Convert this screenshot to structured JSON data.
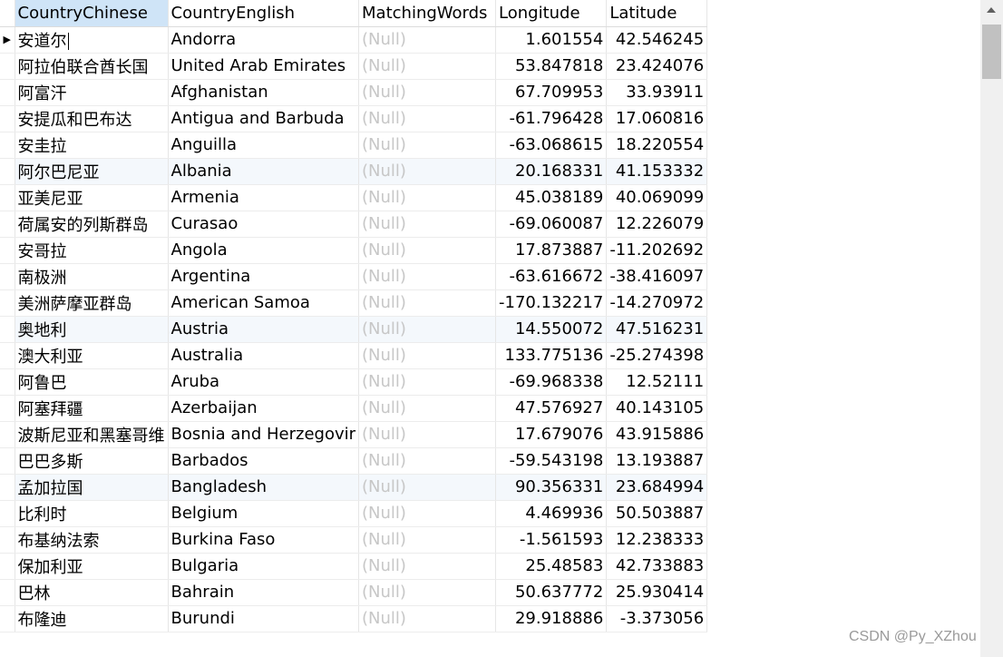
{
  "columns": [
    "CountryChinese",
    "CountryEnglish",
    "MatchingWords",
    "Longitude",
    "Latitude"
  ],
  "rows": [
    {
      "cn": "安道尔",
      "en": "Andorra",
      "mw": "(Null)",
      "lon": "1.601554",
      "lat": "42.546245"
    },
    {
      "cn": "阿拉伯联合酋长国",
      "en": "United Arab Emirates",
      "mw": "(Null)",
      "lon": "53.847818",
      "lat": "23.424076"
    },
    {
      "cn": "阿富汗",
      "en": "Afghanistan",
      "mw": "(Null)",
      "lon": "67.709953",
      "lat": "33.93911"
    },
    {
      "cn": "安提瓜和巴布达",
      "en": "Antigua and Barbuda",
      "mw": "(Null)",
      "lon": "-61.796428",
      "lat": "17.060816"
    },
    {
      "cn": "安圭拉",
      "en": "Anguilla",
      "mw": "(Null)",
      "lon": "-63.068615",
      "lat": "18.220554"
    },
    {
      "cn": "阿尔巴尼亚",
      "en": "Albania",
      "mw": "(Null)",
      "lon": "20.168331",
      "lat": "41.153332"
    },
    {
      "cn": "亚美尼亚",
      "en": "Armenia",
      "mw": "(Null)",
      "lon": "45.038189",
      "lat": "40.069099"
    },
    {
      "cn": "荷属安的列斯群岛",
      "en": "Curasao",
      "mw": "(Null)",
      "lon": "-69.060087",
      "lat": "12.226079"
    },
    {
      "cn": "安哥拉",
      "en": "Angola",
      "mw": "(Null)",
      "lon": "17.873887",
      "lat": "-11.202692"
    },
    {
      "cn": "南极洲",
      "en": "Argentina",
      "mw": "(Null)",
      "lon": "-63.616672",
      "lat": "-38.416097"
    },
    {
      "cn": "美洲萨摩亚群岛",
      "en": "American Samoa",
      "mw": "(Null)",
      "lon": "-170.132217",
      "lat": "-14.270972"
    },
    {
      "cn": "奥地利",
      "en": "Austria",
      "mw": "(Null)",
      "lon": "14.550072",
      "lat": "47.516231"
    },
    {
      "cn": "澳大利亚",
      "en": "Australia",
      "mw": "(Null)",
      "lon": "133.775136",
      "lat": "-25.274398"
    },
    {
      "cn": "阿鲁巴",
      "en": "Aruba",
      "mw": "(Null)",
      "lon": "-69.968338",
      "lat": "12.52111"
    },
    {
      "cn": "阿塞拜疆",
      "en": "Azerbaijan",
      "mw": "(Null)",
      "lon": "47.576927",
      "lat": "40.143105"
    },
    {
      "cn": "波斯尼亚和黑塞哥维",
      "en": "Bosnia and Herzegovir",
      "mw": "(Null)",
      "lon": "17.679076",
      "lat": "43.915886"
    },
    {
      "cn": "巴巴多斯",
      "en": "Barbados",
      "mw": "(Null)",
      "lon": "-59.543198",
      "lat": "13.193887"
    },
    {
      "cn": "孟加拉国",
      "en": "Bangladesh",
      "mw": "(Null)",
      "lon": "90.356331",
      "lat": "23.684994"
    },
    {
      "cn": "比利时",
      "en": "Belgium",
      "mw": "(Null)",
      "lon": "4.469936",
      "lat": "50.503887"
    },
    {
      "cn": "布基纳法索",
      "en": "Burkina Faso",
      "mw": "(Null)",
      "lon": "-1.561593",
      "lat": "12.238333"
    },
    {
      "cn": "保加利亚",
      "en": "Bulgaria",
      "mw": "(Null)",
      "lon": "25.48583",
      "lat": "42.733883"
    },
    {
      "cn": "巴林",
      "en": "Bahrain",
      "mw": "(Null)",
      "lon": "50.637772",
      "lat": "25.930414"
    },
    {
      "cn": "布隆迪",
      "en": "Burundi",
      "mw": "(Null)",
      "lon": "29.918886",
      "lat": "-3.373056"
    }
  ],
  "highlighted_rows": [
    5,
    11,
    17
  ],
  "current_row": 0,
  "current_row_indicator": "▶",
  "watermark": "CSDN @Py_XZhou",
  "colors": {
    "header_selected_bg": "#cfe4f7",
    "null_text": "#c7c7c7",
    "row_highlight": "#f4f8fc",
    "scroll_thumb": "#c1c1c1"
  }
}
